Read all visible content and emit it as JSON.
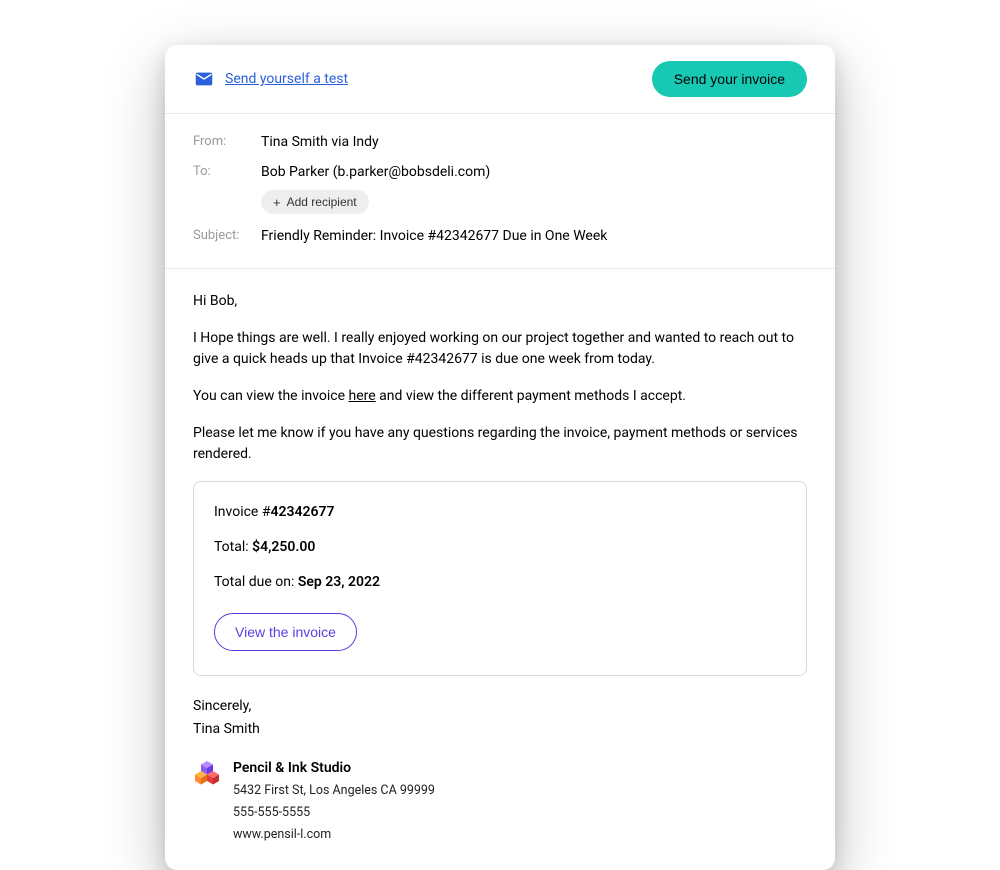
{
  "header": {
    "test_link_label": "Send yourself a test",
    "send_button_label": "Send your invoice"
  },
  "meta": {
    "from_label": "From:",
    "from_value": "Tina Smith via Indy",
    "to_label": "To:",
    "to_value": "Bob Parker (b.parker@bobsdeli.com)",
    "add_recipient_label": "Add recipient",
    "subject_label": "Subject:",
    "subject_value": "Friendly Reminder: Invoice #42342677 Due in One Week"
  },
  "body": {
    "greeting": "Hi Bob,",
    "para1": "I Hope things are well. I really enjoyed working on our project together and wanted to reach out to give a quick heads up that Invoice #42342677 is due one week from today.",
    "para2_before": "You can view the invoice ",
    "para2_link": "here",
    "para2_after": " and view the different payment methods I accept.",
    "para3": "Please let me know if you have any questions regarding the invoice, payment methods or services rendered."
  },
  "invoice": {
    "number_prefix": "Invoice #",
    "number": "42342677",
    "total_prefix": "Total: ",
    "total_value": "$4,250.00",
    "due_prefix": "Total due on: ",
    "due_value": "Sep 23, 2022",
    "view_button_label": "View the invoice"
  },
  "signoff": {
    "closing": "Sincerely,",
    "name": "Tina Smith"
  },
  "company": {
    "name": "Pencil & Ink Studio",
    "address": "5432 First St, Los Angeles CA 99999",
    "phone": "555-555-5555",
    "website": "www.pensil-l.com"
  }
}
